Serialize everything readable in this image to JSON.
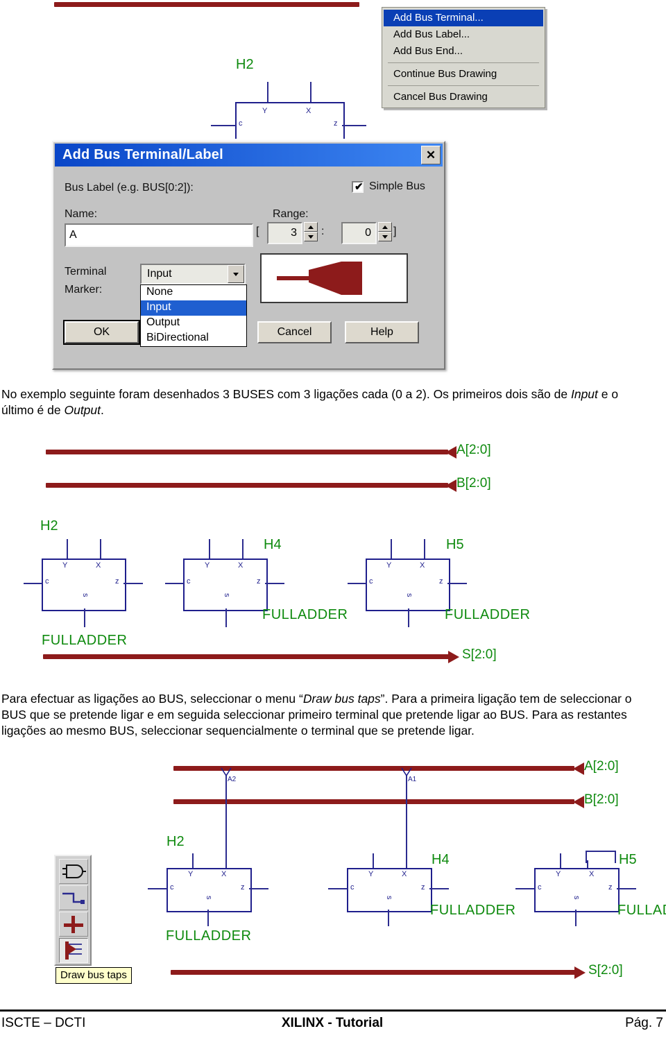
{
  "context_menu": {
    "items": [
      {
        "label": "Add Bus Terminal...",
        "selected": true
      },
      {
        "label": "Add Bus Label...",
        "selected": false
      },
      {
        "label": "Add Bus End...",
        "selected": false
      },
      {
        "label": "Continue Bus Drawing",
        "selected": false
      },
      {
        "label": "Cancel Bus Drawing",
        "selected": false
      }
    ]
  },
  "dialog": {
    "title": "Add Bus Terminal/Label",
    "close_label": "✕",
    "bus_label_caption": "Bus Label (e.g. BUS[0:2]):",
    "simple_bus_label": "Simple Bus",
    "simple_bus_checked": "✔",
    "name_label": "Name:",
    "name_value": "A",
    "range_label": "Range:",
    "bracket_open": "[",
    "bracket_close": "]",
    "range_separator": ":",
    "range_high": "3",
    "range_low": "0",
    "terminal_label_line1": "Terminal",
    "terminal_label_line2": "Marker:",
    "terminal_value": "Input",
    "terminal_options": [
      {
        "label": "None",
        "selected": false
      },
      {
        "label": "Input",
        "selected": true
      },
      {
        "label": "Output",
        "selected": false
      },
      {
        "label": "BiDirectional",
        "selected": false
      }
    ],
    "ok_label": "OK",
    "cancel_label": "Cancel",
    "help_label": "Help"
  },
  "top_schematic": {
    "symbol_name": "H2",
    "pins": {
      "y": "Y",
      "x": "X",
      "c": "c",
      "z": "z"
    }
  },
  "paragraph1": {
    "part1": "No exemplo seguinte foram desenhados 3 BUSES com 3 ligações cada (0 a 2). Os primeiros dois são de ",
    "em1": "Input",
    "part2": " e o último é de ",
    "em2": "Output",
    "part3": "."
  },
  "paragraph2": {
    "part1": "Para efectuar as ligações ao BUS, seleccionar o menu “",
    "em1": "Draw bus taps",
    "part2": "”. Para a primeira ligação tem de seleccionar o BUS que se pretende ligar e em seguida seleccionar primeiro terminal que pretende ligar ao BUS. Para as restantes ligações ao mesmo BUS, seleccionar sequencialmente o terminal que se pretende ligar."
  },
  "mid_schematic": {
    "buses": [
      {
        "name": "A[2:0]",
        "direction": "input"
      },
      {
        "name": "B[2:0]",
        "direction": "input"
      },
      {
        "name": "S[2:0]",
        "direction": "output"
      }
    ],
    "symbols": [
      {
        "instance": "H2",
        "type": "FULLADDER"
      },
      {
        "instance": "H4",
        "type": "FULLADDER"
      },
      {
        "instance": "H5",
        "type": "FULLADDER"
      }
    ],
    "pins": {
      "y": "Y",
      "x": "X",
      "c": "c",
      "z": "z",
      "s": "s"
    }
  },
  "bottom_schematic": {
    "buses": [
      {
        "name": "A[2:0]",
        "direction": "input"
      },
      {
        "name": "B[2:0]",
        "direction": "input"
      },
      {
        "name": "S[2:0]",
        "direction": "output"
      }
    ],
    "symbols": [
      {
        "instance": "H2",
        "type": "FULLADDER"
      },
      {
        "instance": "H4",
        "type": "FULLADDER"
      },
      {
        "instance": "H5",
        "type": "FULLADDER"
      }
    ],
    "bus_taps": [
      {
        "label": "A2"
      },
      {
        "label": "A1"
      }
    ],
    "pins": {
      "y": "Y",
      "x": "X",
      "c": "c",
      "z": "z",
      "s": "s"
    },
    "toolbar": {
      "buttons": [
        {
          "icon": "add-symbol-icon"
        },
        {
          "icon": "draw-wire-icon"
        },
        {
          "icon": "draw-bus-icon"
        },
        {
          "icon": "draw-bus-taps-icon"
        }
      ],
      "tooltip": "Draw bus taps"
    }
  },
  "colors": {
    "bus_red": "#8d1b1b",
    "wire_blue": "#1f1f8c",
    "label_green": "#0e8a0e",
    "title_blue": "#0a46c8",
    "highlight_blue": "#1f5fd0"
  },
  "footer": {
    "left": "ISCTE – DCTI",
    "center": "XILINX - Tutorial",
    "right": "Pág. 7"
  }
}
